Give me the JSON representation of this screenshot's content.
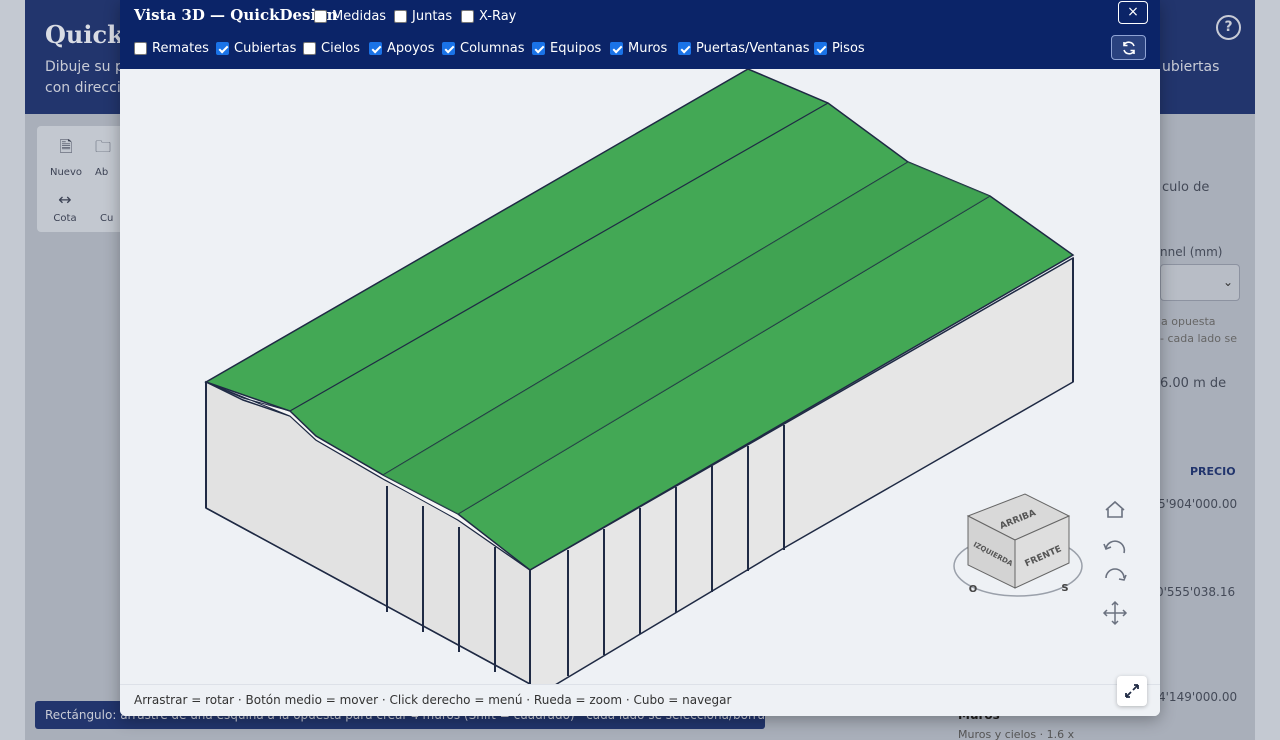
{
  "background": {
    "app_title": "QuickD",
    "description_line1": "Dibuje su pr",
    "description_line2": "con direcció",
    "description_right": "ubiertas",
    "help_label": "?",
    "toolbar": {
      "new_label": "Nuevo",
      "open_label": "Ab",
      "dimension_label": "Cota",
      "other_label": "Cu"
    },
    "right_panel": {
      "calc_text": "culo de",
      "channel_label": "nnel (mm)",
      "hint_line1": "la opuesta",
      "hint_line2": "- cada lado se",
      "length_text": "6.00 m de",
      "price_header": "PRECIO",
      "price_1": "5'904'000.00",
      "price_2": "0'555'038.16",
      "price_3": "4'149'000.00",
      "walls_label": "Muros",
      "walls_sub": "Muros y cielos · 1.6 x"
    },
    "status_text": "Rectángulo: arrastre de una esquina a la opuesta para crear 4 muros (Shift = cuadrado) · cada lado se selecciona/borra por separado"
  },
  "modal": {
    "title": "Vista 3D — QuickDesign",
    "close_label": "×",
    "toggles_row1": [
      {
        "label": "Medidas",
        "checked": false
      },
      {
        "label": "Juntas",
        "checked": false
      },
      {
        "label": "X-Ray",
        "checked": false
      }
    ],
    "toggles_row2": [
      {
        "label": "Remates",
        "checked": false
      },
      {
        "label": "Cubiertas",
        "checked": true
      },
      {
        "label": "Cielos",
        "checked": false
      },
      {
        "label": "Apoyos",
        "checked": true
      },
      {
        "label": "Columnas",
        "checked": true
      },
      {
        "label": "Equipos",
        "checked": true
      },
      {
        "label": "Muros",
        "checked": true
      },
      {
        "label": "Puertas/Ventanas",
        "checked": true
      },
      {
        "label": "Pisos",
        "checked": true
      }
    ],
    "hint": "Arrastrar = rotar · Botón medio = mover · Click derecho = menú · Rueda = zoom · Cubo = navegar",
    "viewcube": {
      "top": "ARRIBA",
      "left": "IZQUIERDA",
      "front": "FRENTE",
      "compass_west": "O",
      "compass_south": "S"
    },
    "colors": {
      "header": "#0b2468",
      "roof": "#43a855",
      "wall": "#e4e4e4",
      "edge": "#1f2a44"
    }
  }
}
